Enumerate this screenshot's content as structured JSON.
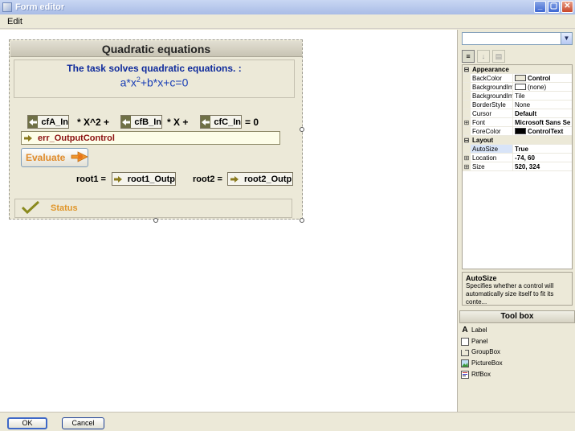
{
  "window": {
    "title": "Form editor",
    "buttons": {
      "minimize": "_",
      "maximize": "▢",
      "close": "✕"
    }
  },
  "menu": {
    "items": [
      "Edit"
    ]
  },
  "form": {
    "title": "Quadratic equations",
    "description": "The task solves quadratic equations. :",
    "equation": {
      "a": "a*x",
      "exp": "2",
      "rest": "+b*x+c=0"
    },
    "inputs": {
      "cfA": "cfA_In",
      "cfB": "cfB_In",
      "cfC": "cfC_In"
    },
    "eq_parts": {
      "x2": "* X^2 +",
      "x1": "* X +",
      "eq0": "= 0"
    },
    "error_control": "err_OutputControl",
    "evaluate_label": "Evaluate",
    "root1_label": "root1 =",
    "root1_value": "root1_Outp",
    "root2_label": "root2 =",
    "root2_value": "root2_Outp",
    "status_label": "Status"
  },
  "properties": {
    "object_selector": "",
    "categories": {
      "appearance": "Appearance",
      "layout": "Layout"
    },
    "rows": {
      "backcolor": {
        "name": "BackColor",
        "value": "Control",
        "swatch": "#ece9d8"
      },
      "bgimage": {
        "name": "BackgroundIm",
        "value": "(none)",
        "swatch": "#ffffff"
      },
      "bglayout": {
        "name": "BackgroundIm",
        "value": "Tile"
      },
      "borderstyle": {
        "name": "BorderStyle",
        "value": "None"
      },
      "cursor": {
        "name": "Cursor",
        "value": "Default"
      },
      "font": {
        "name": "Font",
        "value": "Microsoft Sans Se"
      },
      "forecolor": {
        "name": "ForeColor",
        "value": "ControlText",
        "swatch": "#000000"
      },
      "autosize": {
        "name": "AutoSize",
        "value": "True"
      },
      "location": {
        "name": "Location",
        "value": "-74, 60"
      },
      "size": {
        "name": "Size",
        "value": "520, 324"
      }
    },
    "help": {
      "title": "AutoSize",
      "text": "Specifies whether a control will automatically size itself to fit its conte..."
    }
  },
  "toolbox": {
    "title": "Tool box",
    "items": {
      "label": "Label",
      "panel": "Panel",
      "groupbox": "GroupBox",
      "picturebox": "PictureBox",
      "rtfbox": "RtfBox"
    }
  },
  "buttons": {
    "ok": "OK",
    "cancel": "Cancel"
  }
}
